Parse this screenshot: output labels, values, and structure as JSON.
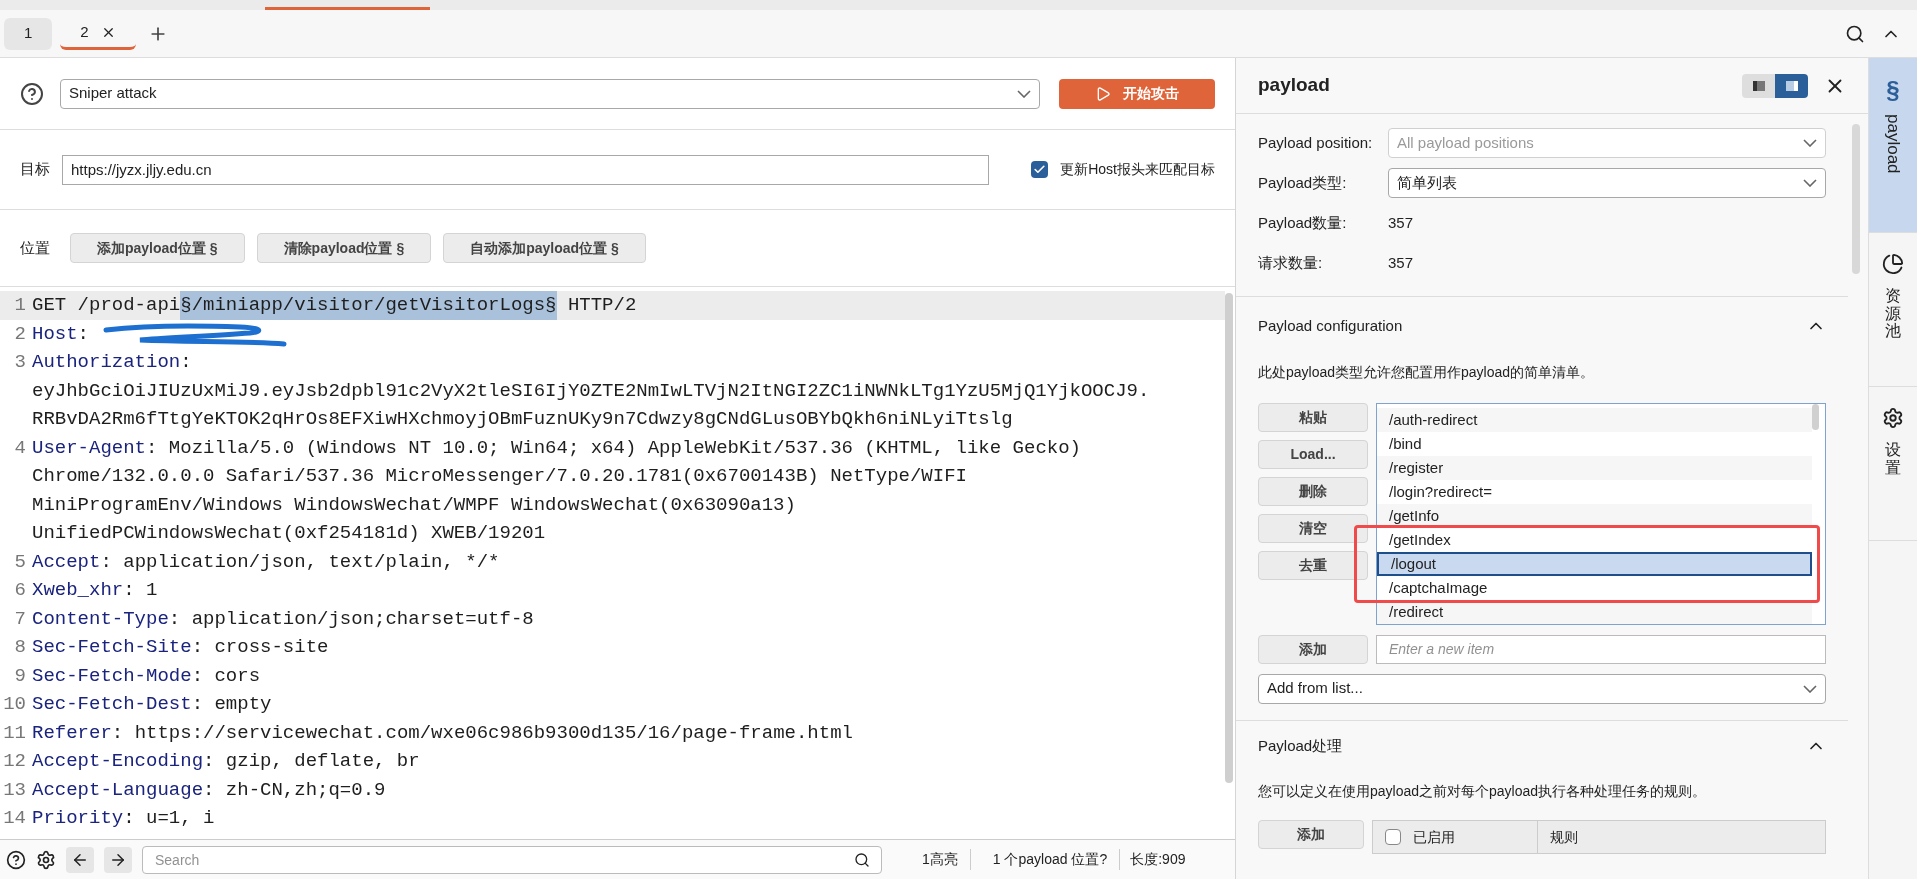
{
  "tabs": [
    {
      "label": "1",
      "selected": false,
      "closable": false
    },
    {
      "label": "2",
      "selected": true,
      "closable": true
    }
  ],
  "attack": {
    "type": "Sniper attack",
    "start_button": "开始攻击"
  },
  "target": {
    "label": "目标",
    "value": "https://jyzx.jljy.edu.cn",
    "update_host": {
      "label": "更新Host报头来匹配目标",
      "checked": true
    }
  },
  "positions": {
    "label": "位置",
    "buttons": [
      "添加payload位置 §",
      "清除payload位置 §",
      "自动添加payload位置 §"
    ]
  },
  "editor": {
    "lines": [
      {
        "number": "1",
        "kind": "request",
        "parts": [
          {
            "text": "GET /prod-api",
            "marked": false
          },
          {
            "text": "§/miniapp/visitor/getVisitorLogs§",
            "marked": true
          },
          {
            "text": " HTTP/2",
            "marked": false
          }
        ]
      },
      {
        "number": "2",
        "kind": "header",
        "name": "Host",
        "sep": ":",
        "redacted": true
      },
      {
        "number": "3",
        "kind": "header",
        "name": "Authorization",
        "sep": ":",
        "continuation": [
          "eyJhbGciOiJIUzUxMiJ9.eyJsb2dpbl91c2VyX2tleSI6IjY0ZTE2NmIwLTVjN2ItNGI2ZC1iNWNkLTg1YzU5MjQ1YjkOOCJ9.",
          "RRBvDA2Rm6fTtgYeKTOK2qHrOs8EFXiwHXchmoyjOBmFuznUKy9n7Cdwzy8gCNdGLusOBYbQkh6niNLyiTtslg"
        ]
      },
      {
        "number": "4",
        "kind": "header",
        "name": "User-Agent",
        "sep": ":",
        "value": "Mozilla/5.0 (Windows NT 10.0; Win64; x64) AppleWebKit/537.36 (KHTML, like Gecko)",
        "continuation": [
          "Chrome/132.0.0.0 Safari/537.36 MicroMessenger/7.0.20.1781(0x6700143B) NetType/WIFI",
          "MiniProgramEnv/Windows WindowsWechat/WMPF WindowsWechat(0x63090a13)",
          "UnifiedPCWindowsWechat(0xf254181d) XWEB/19201"
        ]
      },
      {
        "number": "5",
        "kind": "header",
        "name": "Accept",
        "sep": ":",
        "value": "application/json, text/plain, */*"
      },
      {
        "number": "6",
        "kind": "header",
        "name": "Xweb_xhr",
        "sep": ":",
        "value": "1"
      },
      {
        "number": "7",
        "kind": "header",
        "name": "Content-Type",
        "sep": ":",
        "value": "application/json;charset=utf-8"
      },
      {
        "number": "8",
        "kind": "header",
        "name": "Sec-Fetch-Site",
        "sep": ":",
        "value": "cross-site"
      },
      {
        "number": "9",
        "kind": "header",
        "name": "Sec-Fetch-Mode",
        "sep": ":",
        "value": "cors"
      },
      {
        "number": "10",
        "kind": "header",
        "name": "Sec-Fetch-Dest",
        "sep": ":",
        "value": "empty"
      },
      {
        "number": "11",
        "kind": "header",
        "name": "Referer",
        "sep": ":",
        "value": "https://servicewechat.com/wxe06c986b9300d135/16/page-frame.html"
      },
      {
        "number": "12",
        "kind": "header",
        "name": "Accept-Encoding",
        "sep": ":",
        "value": "gzip, deflate, br"
      },
      {
        "number": "13",
        "kind": "header",
        "name": "Accept-Language",
        "sep": ":",
        "value": "zh-CN,zh;q=0.9"
      },
      {
        "number": "14",
        "kind": "header",
        "name": "Priority",
        "sep": ":",
        "value": "u=1, i"
      }
    ]
  },
  "status_bar": {
    "search_placeholder": "Search",
    "highlights": "1高亮",
    "positions": "1 个payload 位置?",
    "length": "长度:909"
  },
  "payload_panel": {
    "title": "payload",
    "fields": [
      {
        "label": "Payload position:",
        "value": "All payload positions",
        "kind": "select",
        "disabled": true
      },
      {
        "label": "Payload类型:",
        "value": "简单列表",
        "kind": "select",
        "disabled": false
      },
      {
        "label": "Payload数量:",
        "value": "357",
        "kind": "text"
      },
      {
        "label": "请求数量:",
        "value": "357",
        "kind": "text"
      }
    ],
    "configuration": {
      "title": "Payload configuration",
      "expanded": true,
      "description": "此处payload类型允许您配置用作payload的简单清单。",
      "buttons": [
        "粘贴",
        "Load...",
        "删除",
        "清空",
        "去重"
      ],
      "items": [
        {
          "text": "/auth-redirect",
          "selected": false
        },
        {
          "text": "/bind",
          "selected": false
        },
        {
          "text": "/register",
          "selected": false
        },
        {
          "text": "/login?redirect=",
          "selected": false
        },
        {
          "text": "/getInfo",
          "selected": false
        },
        {
          "text": "/getIndex",
          "selected": false
        },
        {
          "text": "/logout",
          "selected": true
        },
        {
          "text": "/captchaImage",
          "selected": false
        },
        {
          "text": "/redirect",
          "selected": false
        }
      ],
      "add_button": "添加",
      "add_placeholder": "Enter a new item",
      "add_from_list": "Add from list..."
    },
    "processing": {
      "title": "Payload处理",
      "expanded": true,
      "description": "您可以定义在使用payload之前对每个payload执行各种处理任务的规则。",
      "add_button": "添加",
      "select_all_checked": false,
      "columns": [
        "已启用",
        "规则"
      ]
    }
  },
  "side_tabs": [
    {
      "label": "payload",
      "kind": "section",
      "icon": "§",
      "selected": true
    },
    {
      "label": "资源池",
      "kind": "pie",
      "selected": false
    },
    {
      "label": "设置",
      "kind": "gear",
      "selected": false
    }
  ]
}
